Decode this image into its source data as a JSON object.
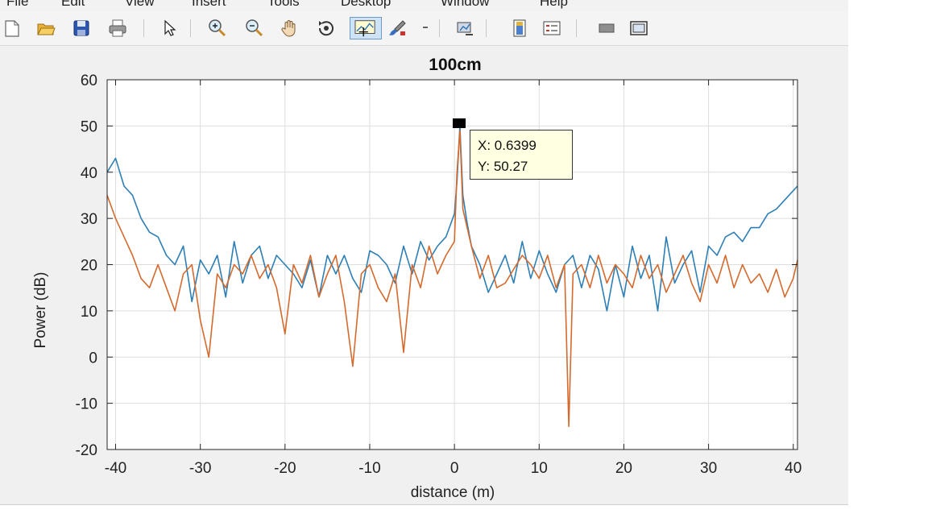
{
  "menubar": {
    "items": [
      "File",
      "Edit",
      "View",
      "Insert",
      "Tools",
      "Desktop",
      "Window",
      "Help"
    ]
  },
  "toolbar": {
    "icons": [
      "new-figure-icon",
      "open-file-icon",
      "save-icon",
      "print-icon",
      "edit-plot-arrow-icon",
      "zoom-in-icon",
      "zoom-out-icon",
      "pan-hand-icon",
      "rotate-3d-icon",
      "data-cursor-icon",
      "brush-icon",
      "brush-dropdown-icon",
      "link-plot-icon",
      "insert-colorbar-icon",
      "insert-legend-icon",
      "hide-plot-tools-icon",
      "show-plot-tools-icon"
    ]
  },
  "datatip": {
    "x_label": "X: 0.6399",
    "y_label": "Y: 50.27"
  },
  "chart_data": {
    "type": "line",
    "title": "100cm",
    "xlabel": "distance (m)",
    "ylabel": "Power (dB)",
    "xlim": [
      -41,
      40.5
    ],
    "ylim": [
      -20,
      60
    ],
    "xticks": [
      -40,
      -30,
      -20,
      -10,
      0,
      10,
      20,
      30,
      40
    ],
    "xtick_labels": [
      "-40",
      "-30",
      "-20",
      "-10",
      "0",
      "10",
      "20",
      "30",
      "40"
    ],
    "yticks": [
      60,
      50,
      40,
      30,
      20,
      10,
      0,
      -10,
      -20
    ],
    "ytick_labels": [
      "60",
      "50",
      "40",
      "30",
      "20",
      "10",
      "0",
      "-10",
      "-20"
    ],
    "grid": true,
    "colors": {
      "series1": "#2e7fb5",
      "series2": "#d46a2e"
    },
    "series": [
      {
        "color": "#2e7fb5",
        "x": [
          -41,
          -40,
          -39,
          -38,
          -37,
          -36,
          -35,
          -34,
          -33,
          -32,
          -31,
          -30,
          -29,
          -28,
          -27,
          -26,
          -25,
          -24,
          -23,
          -22,
          -21,
          -20,
          -19,
          -18,
          -17,
          -16,
          -15,
          -14,
          -13,
          -12,
          -11,
          -10,
          -9,
          -8,
          -7,
          -6,
          -5,
          -4,
          -3,
          -2,
          -1,
          0,
          0.3,
          0.64,
          1,
          1.5,
          2,
          3,
          4,
          5,
          6,
          7,
          8,
          9,
          10,
          11,
          12,
          13,
          14,
          15,
          16,
          17,
          18,
          19,
          20,
          21,
          22,
          23,
          24,
          25,
          26,
          27,
          28,
          29,
          30,
          31,
          32,
          33,
          34,
          35,
          36,
          37,
          38,
          39,
          40,
          40.5
        ],
        "y": [
          40,
          43,
          37,
          35,
          30,
          27,
          26,
          22,
          20,
          24,
          12,
          21,
          18,
          22,
          13,
          25,
          16,
          22,
          24,
          17,
          22,
          20,
          18,
          15,
          21,
          13,
          22,
          18,
          22,
          17,
          14,
          23,
          22,
          20,
          16,
          24,
          18,
          25,
          21,
          24,
          26,
          31,
          38,
          50,
          35,
          29,
          24,
          20,
          14,
          18,
          22,
          16,
          25,
          17,
          23,
          18,
          14,
          20,
          22,
          15,
          22,
          19,
          10,
          20,
          13,
          24,
          17,
          22,
          10,
          26,
          16,
          20,
          23,
          14,
          24,
          22,
          26,
          27,
          25,
          28,
          28,
          31,
          32,
          34,
          36,
          37
        ]
      },
      {
        "color": "#d46a2e",
        "x": [
          -41,
          -40,
          -39,
          -38,
          -37,
          -36,
          -35,
          -34,
          -33,
          -32,
          -31,
          -30,
          -29,
          -28,
          -27,
          -26,
          -25,
          -24,
          -23,
          -22,
          -21,
          -20,
          -19,
          -18,
          -17,
          -16,
          -15,
          -14,
          -13,
          -12,
          -11,
          -10,
          -9,
          -8,
          -7,
          -6,
          -5,
          -4,
          -3,
          -2,
          -1,
          0,
          0.3,
          0.64,
          1,
          1.5,
          2,
          3,
          4,
          5,
          6,
          7,
          8,
          9,
          10,
          11,
          12,
          13,
          13.5,
          14,
          15,
          16,
          17,
          18,
          19,
          20,
          21,
          22,
          23,
          24,
          25,
          26,
          27,
          28,
          29,
          30,
          31,
          32,
          33,
          34,
          35,
          36,
          37,
          38,
          39,
          40,
          40.5
        ],
        "y": [
          35,
          30,
          26,
          22,
          17,
          15,
          20,
          15,
          10,
          18,
          20,
          8,
          0,
          18,
          15,
          20,
          18,
          22,
          17,
          20,
          15,
          5,
          20,
          16,
          22,
          13,
          18,
          22,
          12,
          -2,
          18,
          20,
          15,
          12,
          18,
          1,
          20,
          15,
          24,
          18,
          22,
          25,
          40,
          49,
          32,
          28,
          24,
          17,
          22,
          15,
          16,
          19,
          22,
          20,
          17,
          22,
          15,
          20,
          -15,
          18,
          20,
          15,
          22,
          16,
          20,
          18,
          15,
          22,
          17,
          20,
          14,
          18,
          22,
          16,
          12,
          20,
          16,
          22,
          15,
          20,
          16,
          18,
          14,
          19,
          13,
          17,
          21
        ]
      }
    ],
    "datatip": {
      "x": 0.6399,
      "y": 50.27
    }
  }
}
